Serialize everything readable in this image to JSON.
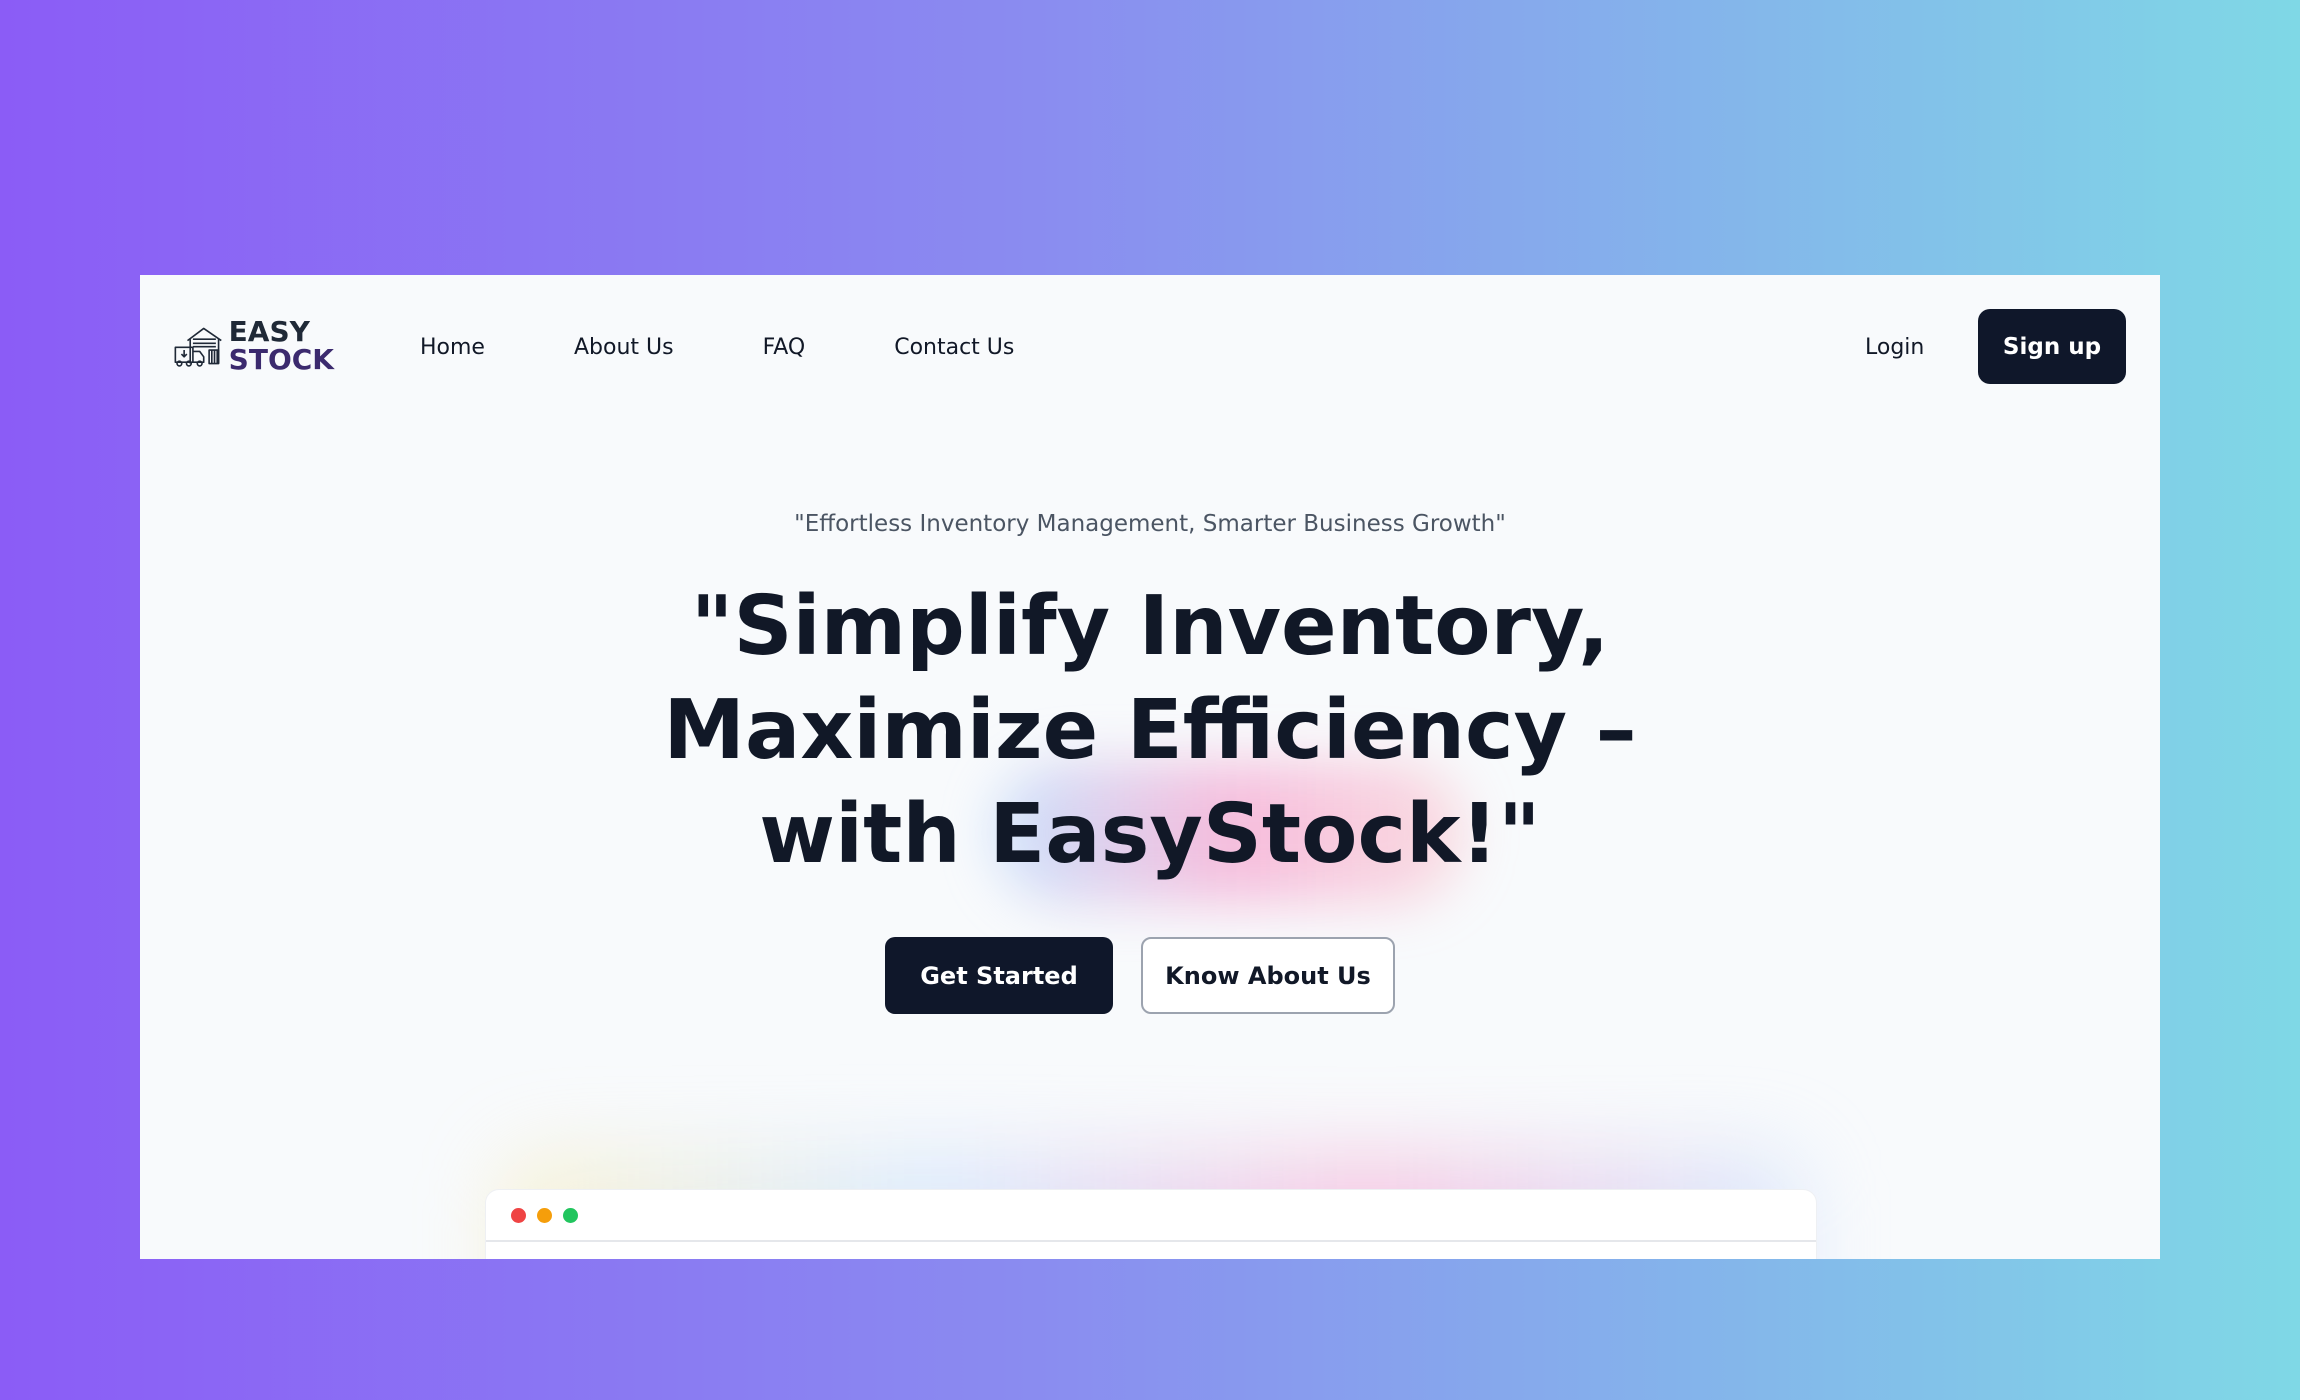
{
  "brand": {
    "logo_line1": "EASY",
    "logo_line2": "STOCK"
  },
  "nav": {
    "links": [
      {
        "label": "Home"
      },
      {
        "label": "About Us"
      },
      {
        "label": "FAQ"
      },
      {
        "label": "Contact Us"
      }
    ],
    "login_label": "Login",
    "signup_label": "Sign up"
  },
  "hero": {
    "tagline": "\"Effortless Inventory Management, Smarter Business Growth\"",
    "headline_line1": "\"Simplify Inventory,",
    "headline_line2": "Maximize Efficiency –",
    "headline_line3": "with EasyStock!\"",
    "primary_cta": "Get Started",
    "secondary_cta": "Know About Us"
  },
  "preview": {
    "dot_colors": [
      "#ef4444",
      "#f59e0b",
      "#22c55e"
    ]
  },
  "colors": {
    "accent_dark": "#0f172a",
    "background_gradient_start": "#8b5cf6",
    "background_gradient_end": "#7fd8e6"
  }
}
